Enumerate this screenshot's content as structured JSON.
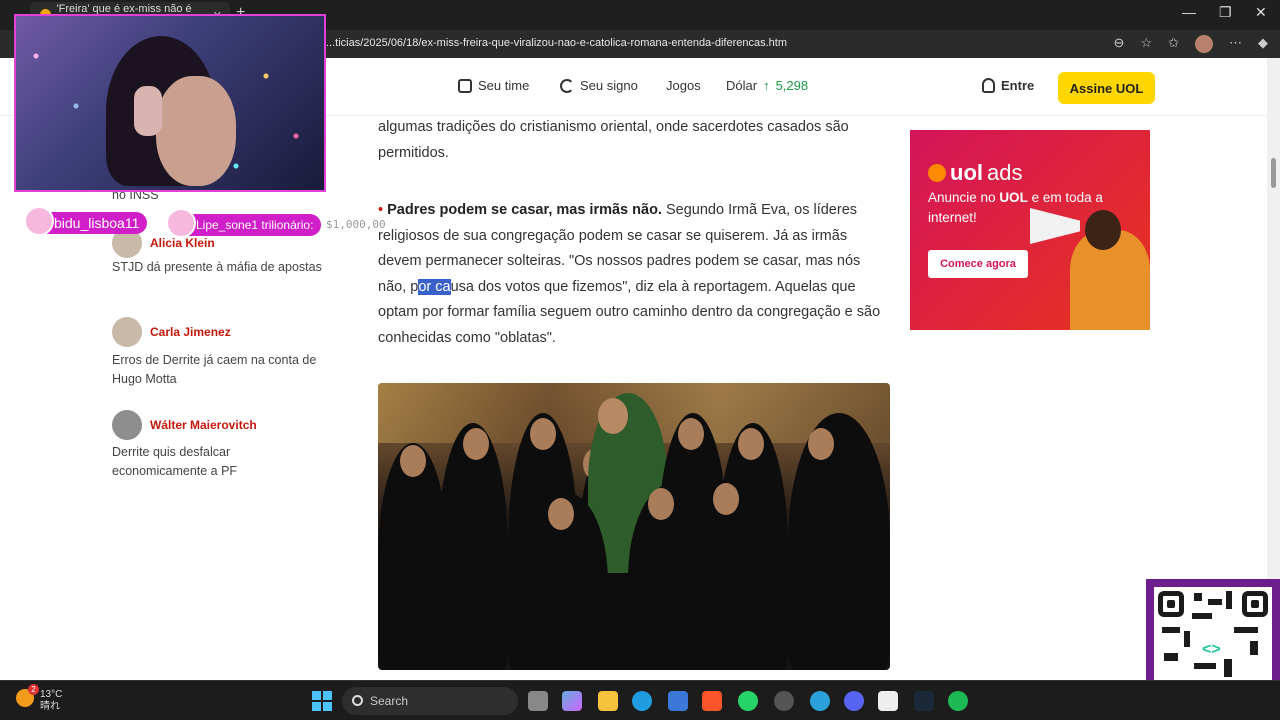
{
  "browser": {
    "tab_title": "'Freira' que é ex-miss não é catól...",
    "url": "...ticias/2025/06/18/ex-miss-freira-que-viralizou-nao-e-catolica-romana-entenda-diferencas.htm"
  },
  "topnav": {
    "seu_time": "Seu time",
    "seu_signo": "Seu signo",
    "jogos": "Jogos",
    "dolar_label": "Dólar",
    "dolar_arrow": "↑",
    "dolar_value": "5,298",
    "entre": "Entre",
    "assine": "Assine UOL"
  },
  "sidebar": {
    "partial_text": "no INSS",
    "columnists": [
      {
        "name": "Alicia Klein",
        "snippet": "STJD dá presente à máfia de apostas"
      },
      {
        "name": "Carla Jimenez",
        "snippet": "Erros de Derrite já caem na conta de Hugo Motta"
      },
      {
        "name": "Wálter Maierovitch",
        "snippet": "Derrite quis desfalcar economicamente a PF"
      }
    ]
  },
  "article": {
    "para1": "algumas tradições do cristianismo oriental, onde sacerdotes casados são permitidos.",
    "para2_bullet": "•",
    "para2_bold": "Padres podem se casar, mas irmãs não.",
    "para2_a": " Segundo Irmã Eva, os líderes religiosos de sua congregação podem se casar se quiserem. Já as irmãs devem permanecer solteiras. \"Os nossos padres podem se casar, mas nós não, p",
    "para2_highlight": "or ca",
    "para2_b": "usa dos votos que fizemos\", diz ela à reportagem. Aquelas que optam por formar família seguem outro caminho dentro da congregação e são conhecidas como \"oblatas\"."
  },
  "ad": {
    "brand_bold": "uol",
    "brand_light": "ads",
    "copy_a": "Anuncie no ",
    "copy_bold": "UOL",
    "copy_b": " e em toda a internet!",
    "cta": "Comece agora"
  },
  "overlay": {
    "chat1": "bidu_lisboa11",
    "chat2": "Lipe_sone1 trilionário:",
    "chat2_tail": "$1,000,00"
  },
  "taskbar": {
    "weather_temp": "13°C",
    "weather_cond": "晴れ",
    "weather_badge": "2",
    "search": "Search"
  }
}
